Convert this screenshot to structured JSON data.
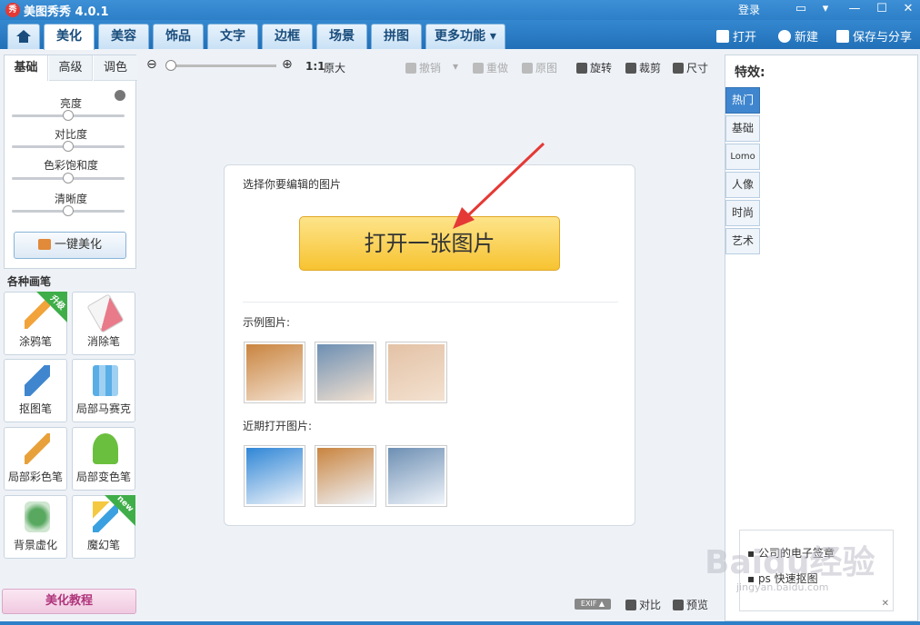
{
  "app": {
    "title": "美图秀秀 4.0.1",
    "logo": "秀",
    "login": "登录"
  },
  "window_controls": {
    "feedback_icon": "chat-icon",
    "menu_icon": "menu-icon",
    "minimize": "—",
    "maximize": "☐",
    "close": "✕"
  },
  "main_tabs": [
    {
      "label": "",
      "icon": "home-icon"
    },
    {
      "label": "美化"
    },
    {
      "label": "美容"
    },
    {
      "label": "饰品"
    },
    {
      "label": "文字"
    },
    {
      "label": "边框"
    },
    {
      "label": "场景"
    },
    {
      "label": "拼图"
    },
    {
      "label": "更多功能 ▾"
    }
  ],
  "menu_actions": {
    "open": "打开",
    "new": "新建",
    "save_share": "保存与分享"
  },
  "left_tabs": [
    "基础",
    "高级",
    "调色"
  ],
  "sliders": [
    {
      "label": "亮度",
      "value": 0.5
    },
    {
      "label": "对比度",
      "value": 0.5
    },
    {
      "label": "色彩饱和度",
      "value": 0.5
    },
    {
      "label": "清晰度",
      "value": 0.5
    }
  ],
  "one_key_label": "一键美化",
  "brush_section_title": "各种画笔",
  "brushes": [
    {
      "label": "涂鸦笔",
      "badge": "升级",
      "color": "#f2a33a"
    },
    {
      "label": "消除笔",
      "badge": "",
      "color": "#e87a8a"
    },
    {
      "label": "抠图笔",
      "badge": "",
      "color": "#3f86cf"
    },
    {
      "label": "局部马赛克",
      "badge": "",
      "color": "#5aaee6"
    },
    {
      "label": "局部彩色笔",
      "badge": "",
      "color": "#e8a13a"
    },
    {
      "label": "局部变色笔",
      "badge": "",
      "color": "#6bbf3e"
    },
    {
      "label": "背景虚化",
      "badge": "",
      "color": "#58a860"
    },
    {
      "label": "魔幻笔",
      "badge": "new",
      "color": "#3aa0e0"
    }
  ],
  "tutorial_label": "美化教程",
  "toolbar": {
    "zoom_out": "⊖",
    "zoom_in": "⊕",
    "zoom_value": 0.0,
    "original_ratio": "1:1",
    "original_size": "原大",
    "undo": "撤销",
    "redo": "重做",
    "original_image": "原图",
    "rotate": "旋转",
    "crop": "裁剪",
    "size": "尺寸"
  },
  "card": {
    "hint": "选择你要编辑的图片",
    "open_button": "打开一张图片",
    "examples_title": "示例图片:",
    "recent_title": "近期打开图片:"
  },
  "example_thumbs": [
    "#c9843f",
    "#6d8fb3",
    "#e3c2a6"
  ],
  "recent_thumbs": [
    "#2f86d6",
    "#c9843f",
    "#6d8fb3"
  ],
  "effects": {
    "title": "特效:",
    "tabs": [
      "热门",
      "基础",
      "Lomo",
      "人像",
      "时尚",
      "艺术"
    ]
  },
  "promo": {
    "items": [
      "公司的电子签章",
      "ps 快速抠图"
    ],
    "close": "✕"
  },
  "status": {
    "exif": "EXIF ▲",
    "compare": "对比",
    "preview": "预览"
  },
  "watermark": {
    "main": "Baidu经验",
    "sub": "jingyan.baidu.com"
  }
}
